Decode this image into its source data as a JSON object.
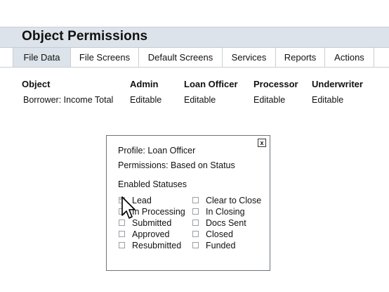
{
  "header": {
    "title": "Object Permissions"
  },
  "tabs": [
    {
      "label": "File Data",
      "active": true
    },
    {
      "label": "File Screens",
      "active": false
    },
    {
      "label": "Default Screens",
      "active": false
    },
    {
      "label": "Services",
      "active": false
    },
    {
      "label": "Reports",
      "active": false
    },
    {
      "label": "Actions",
      "active": false
    }
  ],
  "table": {
    "columns": [
      "Object",
      "Admin",
      "Loan Officer",
      "Processor",
      "Underwriter"
    ],
    "rows": [
      [
        "Borrower: Income Total",
        "Editable",
        "Editable",
        "Editable",
        "Editable"
      ]
    ]
  },
  "dialog": {
    "close_label": "x",
    "profile": "Profile:  Loan Officer",
    "permissions": "Permissions:  Based on Status",
    "section_title": "Enabled Statuses",
    "statuses_left": [
      {
        "label": "Lead",
        "checked": true
      },
      {
        "label": "In Processing",
        "checked": false
      },
      {
        "label": "Submitted",
        "checked": false
      },
      {
        "label": "Approved",
        "checked": false
      },
      {
        "label": "Resubmitted",
        "checked": false
      }
    ],
    "statuses_right": [
      {
        "label": "Clear to Close",
        "checked": false
      },
      {
        "label": "In Closing",
        "checked": false
      },
      {
        "label": "Docs Sent",
        "checked": false
      },
      {
        "label": "Closed",
        "checked": false
      },
      {
        "label": "Funded",
        "checked": false
      }
    ]
  },
  "colors": {
    "header_bg": "#dde3ea",
    "active_tab_bg": "#dde3ea",
    "border": "#c9ced4"
  },
  "icons": {
    "cursor": "mouse-pointer-icon",
    "close": "close-icon",
    "check": "checkmark-icon"
  }
}
